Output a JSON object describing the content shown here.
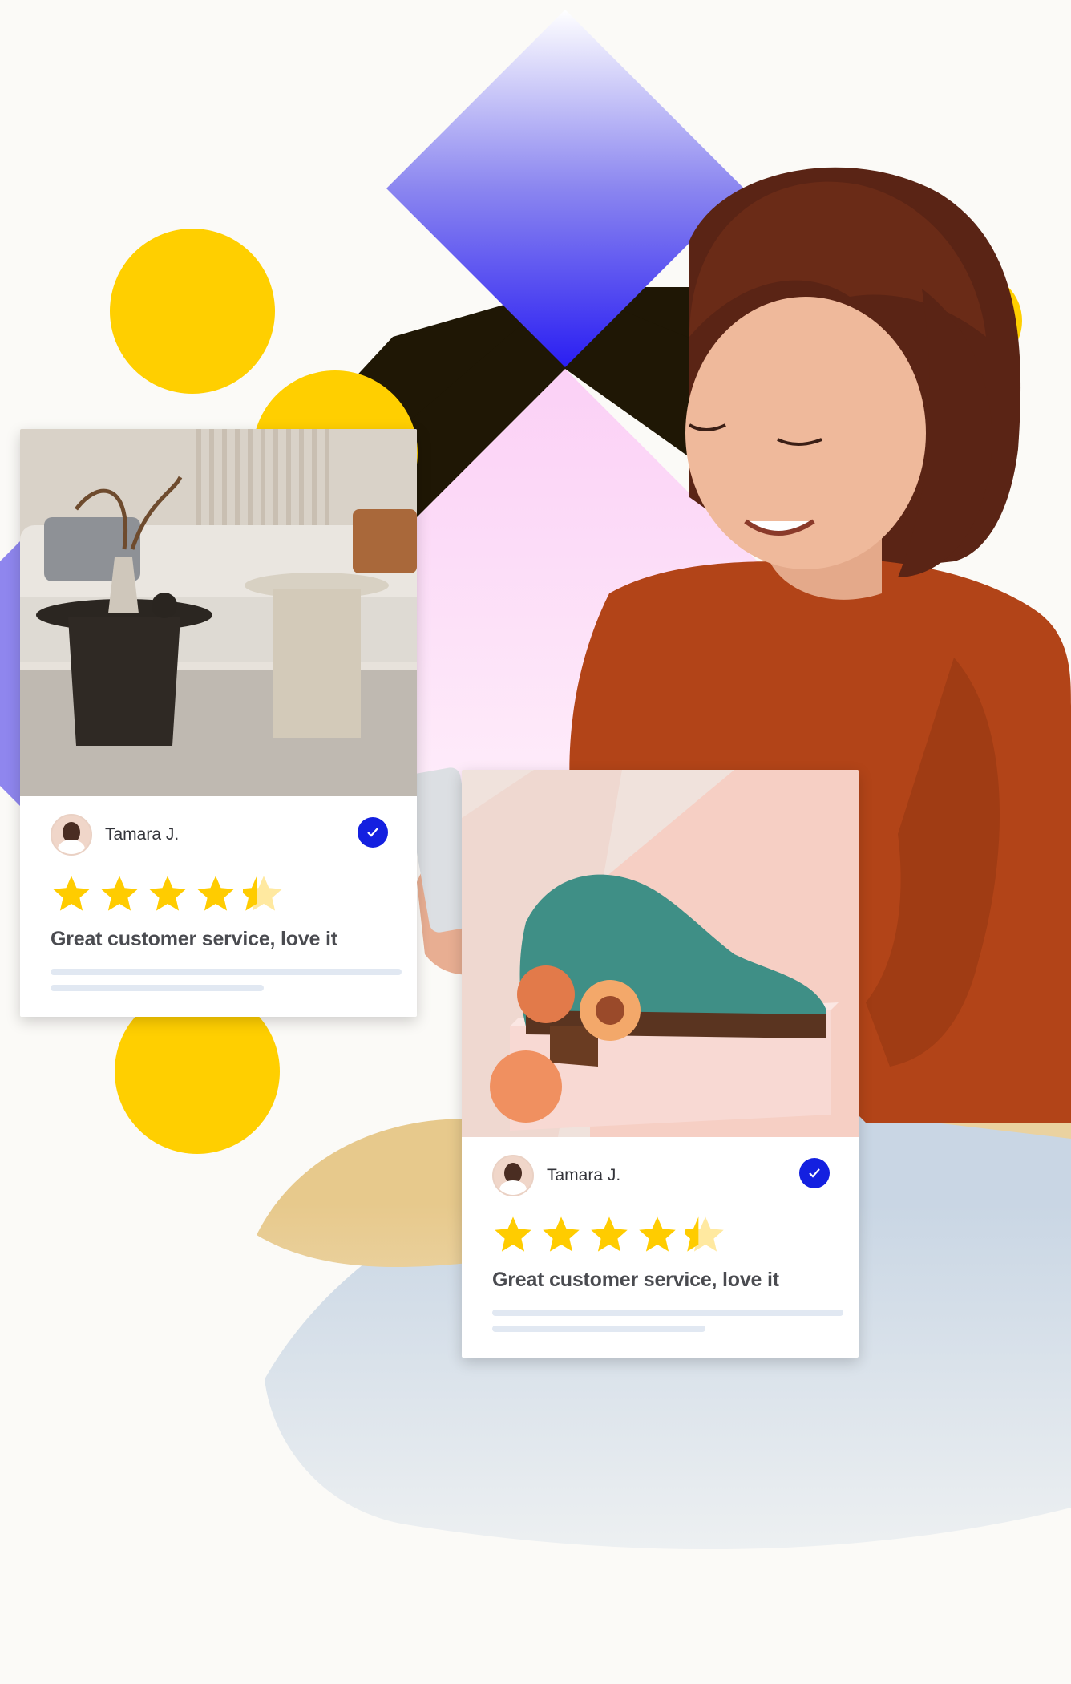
{
  "colors": {
    "accent_blue": "#1420e0",
    "star_yellow": "#ffcc00",
    "circle_yellow": "#ffcf00",
    "diamond_dark": "#1f1705",
    "sweater": "#b24418"
  },
  "icons": {
    "verified": "check-circle-icon",
    "rating": "star-icon"
  },
  "cards": [
    {
      "image": "living-room-coffee-tables",
      "reviewer_name": "Tamara J.",
      "rating": 4.5,
      "review_text": "Great customer service, love it"
    },
    {
      "image": "green-suede-shoe-with-peaches",
      "reviewer_name": "Tamara J.",
      "rating": 4.5,
      "review_text": "Great customer service, love it"
    }
  ]
}
